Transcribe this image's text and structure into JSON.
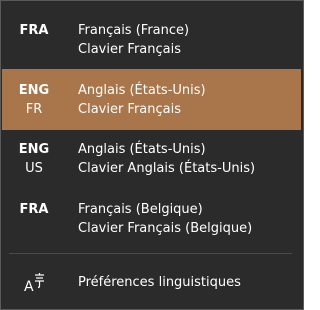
{
  "languages": [
    {
      "code": "FRA",
      "sub": "",
      "name": "Français (France)",
      "keyboard": "Clavier Français",
      "selected": false
    },
    {
      "code": "ENG",
      "sub": "FR",
      "name": "Anglais (États-Unis)",
      "keyboard": "Clavier Français",
      "selected": true
    },
    {
      "code": "ENG",
      "sub": "US",
      "name": "Anglais (États-Unis)",
      "keyboard": "Clavier Anglais (États-Unis)",
      "selected": false
    },
    {
      "code": "FRA",
      "sub": "",
      "name": "Français (Belgique)",
      "keyboard": "Clavier Français (Belgique)",
      "selected": false
    }
  ],
  "preferences": {
    "label": "Préférences linguistiques",
    "icon": "language-settings-icon"
  },
  "colors": {
    "background": "#2b2b2b",
    "selected": "#a8764a",
    "text": "#ffffff"
  }
}
